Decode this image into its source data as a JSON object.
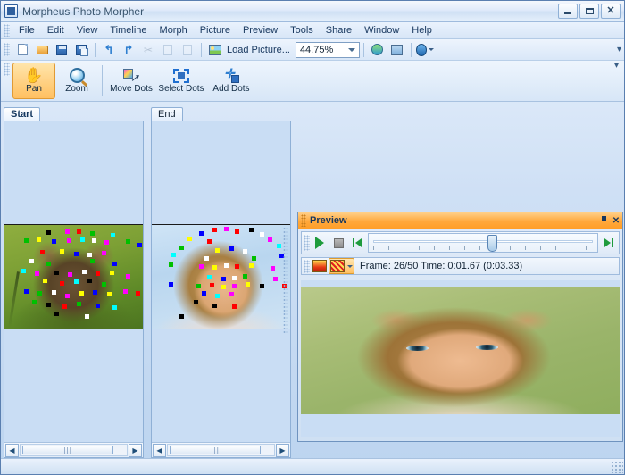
{
  "window": {
    "title": "Morpheus Photo Morpher",
    "app_icon": "app-logo-icon",
    "minimize": "–",
    "maximize": "□",
    "close": "✕"
  },
  "menu": {
    "items": [
      {
        "label": "File"
      },
      {
        "label": "Edit"
      },
      {
        "label": "View"
      },
      {
        "label": "Timeline"
      },
      {
        "label": "Morph"
      },
      {
        "label": "Picture"
      },
      {
        "label": "Preview"
      },
      {
        "label": "Tools"
      },
      {
        "label": "Share"
      },
      {
        "label": "Window"
      },
      {
        "label": "Help"
      }
    ]
  },
  "toolbar": {
    "icons": [
      {
        "name": "new-icon"
      },
      {
        "name": "open-icon"
      },
      {
        "name": "save-icon"
      },
      {
        "name": "save-as-icon"
      },
      {
        "name": "undo-icon"
      },
      {
        "name": "redo-icon"
      },
      {
        "name": "cut-icon"
      },
      {
        "name": "copy-icon"
      },
      {
        "name": "paste-icon"
      }
    ],
    "load_picture_label": "Load Picture...",
    "zoom_value": "44.75%",
    "help_glyph": "?",
    "overflow_glyph": "▾"
  },
  "tools": {
    "buttons": [
      {
        "label": "Pan",
        "icon": "hand-icon",
        "selected": true
      },
      {
        "label": "Zoom",
        "icon": "magnifier-icon",
        "selected": false
      },
      {
        "label": "Move Dots",
        "icon": "move-dots-icon",
        "selected": false
      },
      {
        "label": "Select Dots",
        "icon": "select-dots-icon",
        "selected": false
      },
      {
        "label": "Add Dots",
        "icon": "add-dots-icon",
        "selected": false
      }
    ]
  },
  "panes": {
    "start": {
      "tab_label": "Start",
      "active": true
    },
    "end": {
      "tab_label": "End",
      "active": false
    },
    "scroll_thumb_glyph": "|||",
    "left_arrow": "◀",
    "right_arrow": "▶"
  },
  "preview": {
    "title": "Preview",
    "pin_icon": "pin-icon",
    "close_label": "✕",
    "play_icon": "play-icon",
    "stop_icon": "stop-icon",
    "step_back_icon": "step-back-icon",
    "step_forward_icon": "step-forward-icon",
    "slider_position_percent": 52,
    "render_mode_1": "gradient-swatch-icon",
    "render_mode_2": "dither-swatch-icon",
    "render_mode_selected": 2,
    "status_text": "Frame: 26/50 Time: 0:01.67 (0:03.33)",
    "frame_current": 26,
    "frame_total": 50,
    "time_current": "0:01.67",
    "time_total": "0:03.33"
  },
  "colors": {
    "titlebar": "#dfeafa",
    "preview_header": "#ffa83c",
    "accent_selected": "#ffc061",
    "window_border": "#5a7fb0",
    "panel_bg": "#c9ddf4"
  },
  "dots": {
    "palette": [
      "#ff0000",
      "#00c000",
      "#0000ff",
      "#ffff00",
      "#ff00ff",
      "#00ffff",
      "#ffffff",
      "#000000"
    ],
    "start": [
      [
        52,
        4,
        "#ff0000"
      ],
      [
        30,
        5,
        "#000000"
      ],
      [
        44,
        4,
        "#ff00ff"
      ],
      [
        62,
        6,
        "#00c000"
      ],
      [
        77,
        8,
        "#00ffff"
      ],
      [
        14,
        13,
        "#00c000"
      ],
      [
        23,
        12,
        "#ffff00"
      ],
      [
        34,
        14,
        "#0000ff"
      ],
      [
        45,
        13,
        "#ff00ff"
      ],
      [
        55,
        12,
        "#00ffff"
      ],
      [
        63,
        13,
        "#ffffff"
      ],
      [
        72,
        15,
        "#ff00ff"
      ],
      [
        88,
        14,
        "#00c000"
      ],
      [
        96,
        17,
        "#0000ff"
      ],
      [
        26,
        24,
        "#ff0000"
      ],
      [
        40,
        23,
        "#ffff00"
      ],
      [
        50,
        26,
        "#0000ff"
      ],
      [
        60,
        27,
        "#ffffff"
      ],
      [
        70,
        25,
        "#ff00ff"
      ],
      [
        18,
        33,
        "#ffffff"
      ],
      [
        30,
        35,
        "#00c000"
      ],
      [
        62,
        33,
        "#00c000"
      ],
      [
        78,
        35,
        "#0000ff"
      ],
      [
        12,
        42,
        "#00ffff"
      ],
      [
        22,
        45,
        "#ff00ff"
      ],
      [
        36,
        44,
        "#000000"
      ],
      [
        46,
        46,
        "#ff00ff"
      ],
      [
        56,
        43,
        "#ffffff"
      ],
      [
        66,
        45,
        "#ff0000"
      ],
      [
        76,
        44,
        "#ffff00"
      ],
      [
        88,
        47,
        "#ff00ff"
      ],
      [
        28,
        52,
        "#ffff00"
      ],
      [
        40,
        54,
        "#ff0000"
      ],
      [
        50,
        53,
        "#00ffff"
      ],
      [
        60,
        52,
        "#000000"
      ],
      [
        70,
        55,
        "#00c000"
      ],
      [
        14,
        62,
        "#0000ff"
      ],
      [
        24,
        64,
        "#00c000"
      ],
      [
        34,
        63,
        "#ffffff"
      ],
      [
        44,
        66,
        "#ff00ff"
      ],
      [
        54,
        64,
        "#ffff00"
      ],
      [
        64,
        63,
        "#0000ff"
      ],
      [
        74,
        65,
        "#ffff00"
      ],
      [
        86,
        62,
        "#ff00ff"
      ],
      [
        95,
        64,
        "#ff0000"
      ],
      [
        30,
        75,
        "#000000"
      ],
      [
        42,
        77,
        "#ff0000"
      ],
      [
        52,
        74,
        "#00c000"
      ],
      [
        66,
        76,
        "#0000ff"
      ],
      [
        78,
        78,
        "#00ffff"
      ],
      [
        20,
        72,
        "#00c000"
      ],
      [
        58,
        86,
        "#ffffff"
      ],
      [
        36,
        84,
        "#000000"
      ]
    ],
    "end": [
      [
        44,
        3,
        "#ff0000"
      ],
      [
        52,
        2,
        "#ff00ff"
      ],
      [
        60,
        4,
        "#ff0000"
      ],
      [
        70,
        3,
        "#000000"
      ],
      [
        34,
        6,
        "#0000ff"
      ],
      [
        78,
        7,
        "#ffffff"
      ],
      [
        26,
        11,
        "#ffff00"
      ],
      [
        84,
        12,
        "#ff00ff"
      ],
      [
        40,
        14,
        "#ff0000"
      ],
      [
        90,
        18,
        "#00ffff"
      ],
      [
        20,
        20,
        "#00c000"
      ],
      [
        46,
        22,
        "#ffff00"
      ],
      [
        56,
        21,
        "#0000ff"
      ],
      [
        66,
        23,
        "#ffffff"
      ],
      [
        14,
        27,
        "#00ffff"
      ],
      [
        38,
        30,
        "#ffffff"
      ],
      [
        72,
        30,
        "#00c000"
      ],
      [
        92,
        28,
        "#0000ff"
      ],
      [
        12,
        36,
        "#00c000"
      ],
      [
        34,
        38,
        "#ff00ff"
      ],
      [
        44,
        39,
        "#ffff00"
      ],
      [
        52,
        37,
        "#ffffff"
      ],
      [
        60,
        38,
        "#ff0000"
      ],
      [
        70,
        37,
        "#ffff00"
      ],
      [
        86,
        40,
        "#ff00ff"
      ],
      [
        40,
        48,
        "#00ffff"
      ],
      [
        50,
        50,
        "#0000ff"
      ],
      [
        58,
        49,
        "#ffffff"
      ],
      [
        66,
        47,
        "#00c000"
      ],
      [
        88,
        50,
        "#ff00ff"
      ],
      [
        12,
        55,
        "#0000ff"
      ],
      [
        32,
        57,
        "#00c000"
      ],
      [
        42,
        56,
        "#ff0000"
      ],
      [
        50,
        58,
        "#ffff00"
      ],
      [
        58,
        57,
        "#ff00ff"
      ],
      [
        68,
        55,
        "#ffff00"
      ],
      [
        78,
        57,
        "#000000"
      ],
      [
        94,
        57,
        "#ff0000"
      ],
      [
        36,
        64,
        "#0000ff"
      ],
      [
        46,
        66,
        "#00ffff"
      ],
      [
        56,
        65,
        "#ff00ff"
      ],
      [
        30,
        72,
        "#000000"
      ],
      [
        44,
        76,
        "#000000"
      ],
      [
        58,
        77,
        "#ff0000"
      ],
      [
        20,
        86,
        "#000000"
      ]
    ]
  }
}
